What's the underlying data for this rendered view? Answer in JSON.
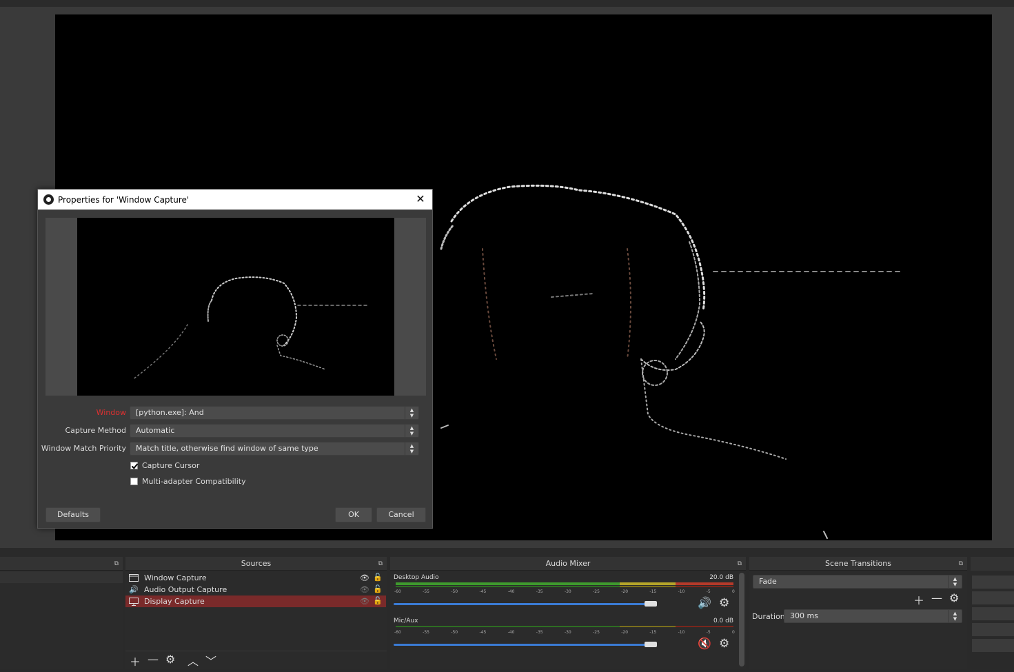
{
  "dialog": {
    "title": "Properties for 'Window Capture'",
    "close_glyph": "✕",
    "fields": [
      {
        "label": "Window",
        "value": "[python.exe]: And"
      },
      {
        "label": "Capture Method",
        "value": "Automatic"
      },
      {
        "label": "Window Match Priority",
        "value": "Match title, otherwise find window of same type"
      }
    ],
    "checkboxes": [
      {
        "label": "Capture Cursor",
        "checked": true
      },
      {
        "label": "Multi-adapter Compatibility",
        "checked": false
      }
    ],
    "defaults_label": "Defaults",
    "ok_label": "OK",
    "cancel_label": "Cancel"
  },
  "sources_dock": {
    "title": "Sources",
    "items": [
      {
        "name": "Window Capture",
        "icon": "window-icon",
        "visible": true
      },
      {
        "name": "Audio Output Capture",
        "icon": "speaker-icon",
        "visible": false
      },
      {
        "name": "Display Capture",
        "icon": "monitor-icon",
        "visible": false,
        "selected": true
      }
    ]
  },
  "audio_mixer": {
    "title": "Audio Mixer",
    "channels": [
      {
        "name": "Desktop Audio",
        "db": "20.0 dB",
        "level": 0.857,
        "muted": false
      },
      {
        "name": "Mic/Aux",
        "db": "0.0 dB",
        "level": 0.857,
        "muted": true
      }
    ],
    "ticks": [
      "-60",
      "-55",
      "-50",
      "-45",
      "-40",
      "-35",
      "-30",
      "-25",
      "-20",
      "-15",
      "-10",
      "-5",
      "0"
    ]
  },
  "scene_transitions": {
    "title": "Scene Transitions",
    "selected": "Fade",
    "duration_label": "Duration",
    "duration_value": "300 ms"
  },
  "colors": {
    "selected_source": "#7a2a2a",
    "meter_green": "#3f9a2e",
    "meter_yellow": "#b5a52a",
    "meter_red": "#b53a2a",
    "slider_blue": "#3a7bd5",
    "window_label_red": "#e03030"
  }
}
